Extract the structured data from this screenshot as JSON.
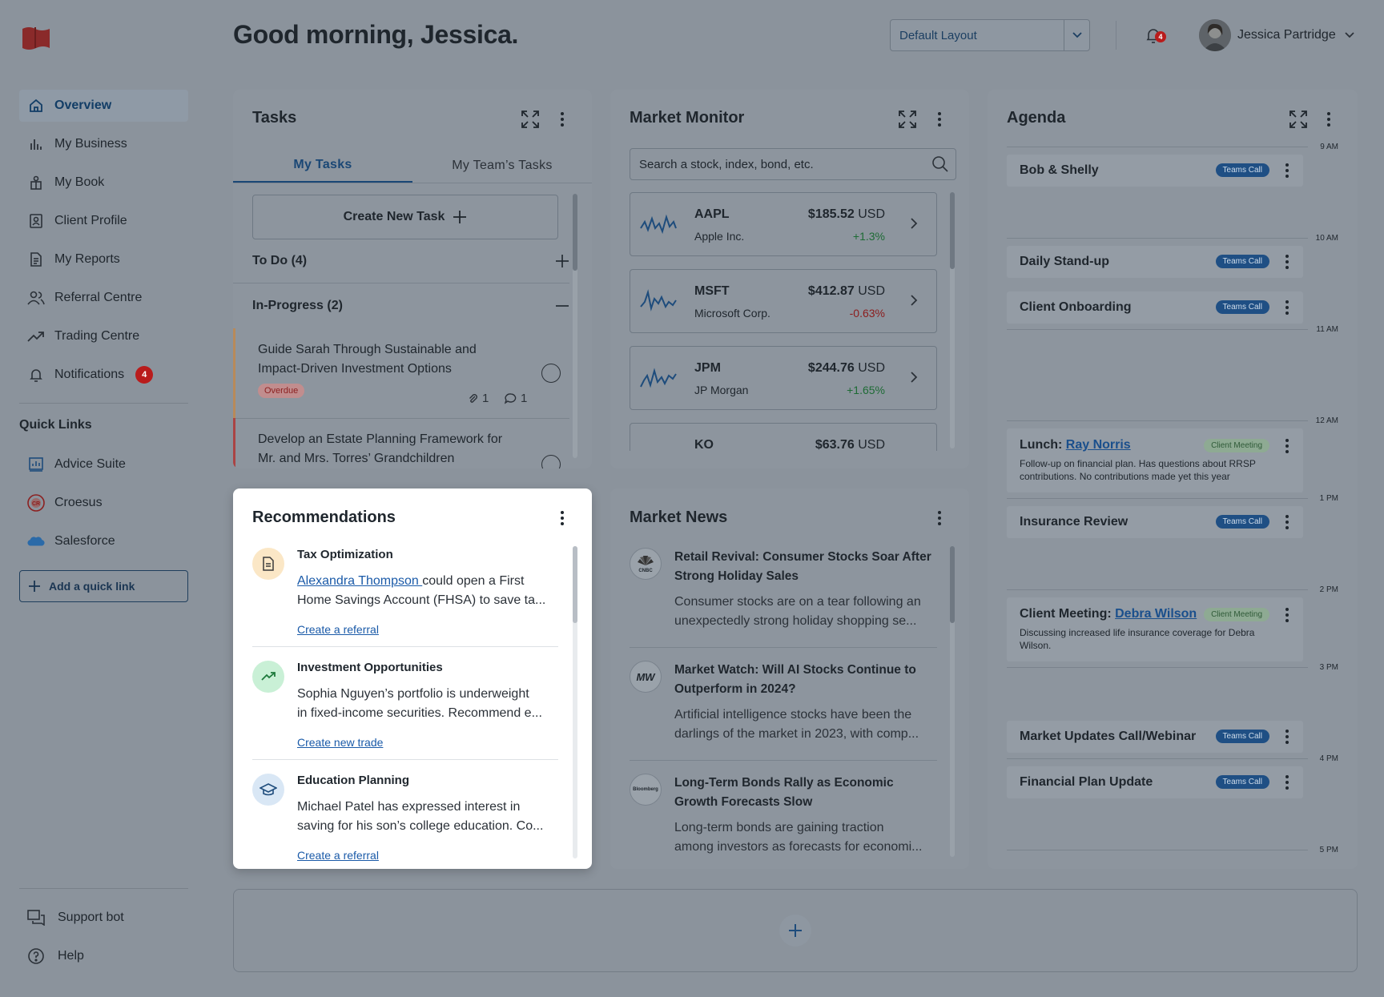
{
  "greeting": "Good morning, Jessica.",
  "header": {
    "layout_select": "Default Layout",
    "notification_count": "4",
    "user_name": "Jessica Partridge"
  },
  "sidebar": {
    "items": [
      {
        "label": "Overview",
        "icon": "home-icon"
      },
      {
        "label": "My Business",
        "icon": "bar-chart-icon"
      },
      {
        "label": "My Book",
        "icon": "book-people-icon"
      },
      {
        "label": "Client Profile",
        "icon": "profile-card-icon"
      },
      {
        "label": "My Reports",
        "icon": "report-icon"
      },
      {
        "label": "Referral Centre",
        "icon": "users-icon"
      },
      {
        "label": "Trading Centre",
        "icon": "trend-icon"
      },
      {
        "label": "Notifications",
        "icon": "bell-icon",
        "badge": "4"
      }
    ],
    "quick_links_title": "Quick Links",
    "quick_links": [
      {
        "label": "Advice Suite",
        "icon": "advice-suite-icon"
      },
      {
        "label": "Croesus",
        "icon": "croesus-icon"
      },
      {
        "label": "Salesforce",
        "icon": "salesforce-icon"
      }
    ],
    "add_quick_link": "Add a quick link",
    "support_bot": "Support bot",
    "help": "Help"
  },
  "tasks": {
    "title": "Tasks",
    "tabs": [
      "My Tasks",
      "My Team’s Tasks"
    ],
    "create_label": "Create New Task",
    "todo_label": "To Do (4)",
    "inprogress_label": "In-Progress (2)",
    "items": [
      {
        "title": "Guide Sarah Through Sustainable and Impact-Driven Investment Options",
        "badge": "Overdue",
        "attachments": "1",
        "comments": "1"
      },
      {
        "title": "Develop an Estate Planning Framework for Mr. and Mrs. Torres’ Grandchildren"
      }
    ]
  },
  "market_monitor": {
    "title": "Market Monitor",
    "search_placeholder": "Search a stock, index, bond, etc.",
    "stocks": [
      {
        "symbol": "AAPL",
        "name": "Apple Inc.",
        "price": "$185.52",
        "currency": "USD",
        "change": "+1.3%"
      },
      {
        "symbol": "MSFT",
        "name": "Microsoft Corp.",
        "price": "$412.87",
        "currency": "USD",
        "change": "-0.63%"
      },
      {
        "symbol": "JPM",
        "name": "JP Morgan",
        "price": "$244.76",
        "currency": "USD",
        "change": "+1.65%"
      },
      {
        "symbol": "KO",
        "name": "",
        "price": "$63.76",
        "currency": "USD",
        "change": ""
      }
    ]
  },
  "recommendations": {
    "title": "Recommendations",
    "items": [
      {
        "title": "Tax Optimization",
        "link_name": "Alexandra Thompson ",
        "line1_rest": "could open a First",
        "line2": "Home Savings Account (FHSA) to save ta...",
        "action": "Create a referral"
      },
      {
        "title": "Investment Opportunities",
        "line1": "Sophia Nguyen’s portfolio is underweight",
        "line2": "in fixed-income securities. Recommend e...",
        "action": "Create new trade"
      },
      {
        "title": "Education Planning",
        "line1": "Michael Patel has expressed interest in",
        "line2": "saving for his son’s college education. Co...",
        "action": "Create a referral"
      }
    ]
  },
  "market_news": {
    "title": "Market News",
    "items": [
      {
        "source": "CNBC",
        "title": "Retail Revival: Consumer Stocks Soar After Strong Holiday Sales",
        "line1": "Consumer stocks are on a tear following an",
        "line2": "unexpectedly strong holiday shopping se..."
      },
      {
        "source": "MW",
        "title": "Market Watch: Will AI Stocks Continue to Outperform in 2024?",
        "line1": "Artificial intelligence stocks have been the",
        "line2": "darlings of the market in 2023, with comp..."
      },
      {
        "source": "Bloomberg",
        "title": "Long-Term Bonds Rally as Economic Growth Forecasts Slow",
        "line1": "Long-term bonds are gaining traction",
        "line2": "among investors as forecasts for economi..."
      }
    ]
  },
  "agenda": {
    "title": "Agenda",
    "times": [
      "9 AM",
      "10 AM",
      "11 AM",
      "12 AM",
      "1 PM",
      "2 PM",
      "3 PM",
      "4 PM",
      "5 PM"
    ],
    "events": [
      {
        "title": "Bob & Shelly",
        "tag": "Teams Call"
      },
      {
        "title": "Daily Stand-up",
        "tag": "Teams Call"
      },
      {
        "title": "Client Onboarding",
        "tag": "Teams Call"
      },
      {
        "title_prefix": "Lunch: ",
        "title_link": "Ray Norris",
        "tag": "Client Meeting",
        "desc": "Follow-up on financial plan. Has questions about RRSP contributions. No contributions made yet this year"
      },
      {
        "title": "Insurance Review",
        "tag": "Teams Call"
      },
      {
        "title_prefix": "Client Meeting: ",
        "title_link": "Debra Wilson",
        "tag": "Client Meeting",
        "desc": "Discussing increased life insurance coverage for Debra Wilson."
      },
      {
        "title": "Market Updates Call/Webinar",
        "tag": "Teams Call"
      },
      {
        "title": "Financial Plan Update",
        "tag": "Teams Call"
      }
    ]
  },
  "colors": {
    "positive": "#1e6b35",
    "negative": "#8c1c1c",
    "accent": "#1a4775",
    "badge": "#b91c1c"
  }
}
